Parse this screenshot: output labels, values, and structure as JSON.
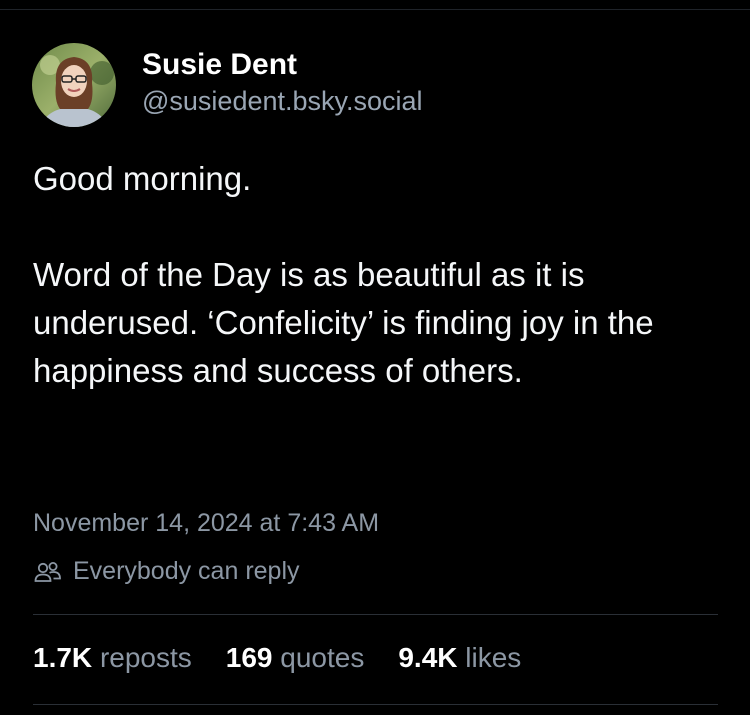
{
  "author": {
    "display_name": "Susie Dent",
    "handle": "@susiedent.bsky.social",
    "avatar_icon": "profile-photo"
  },
  "post": {
    "paragraphs": [
      "Good morning.",
      "Word of the Day is as beautiful as it is underused. ‘Confelicity’ is finding joy in the happiness and success of others."
    ],
    "timestamp": "November 14, 2024 at 7:43 AM",
    "reply_setting": {
      "icon": "people-icon",
      "label": "Everybody can reply"
    }
  },
  "stats": {
    "reposts": {
      "count": "1.7K",
      "label": "reposts"
    },
    "quotes": {
      "count": "169",
      "label": "quotes"
    },
    "likes": {
      "count": "9.4K",
      "label": "likes"
    }
  },
  "colors": {
    "background": "#000000",
    "text": "#ffffff",
    "muted": "#8c97a4",
    "divider": "#2a2f36"
  }
}
